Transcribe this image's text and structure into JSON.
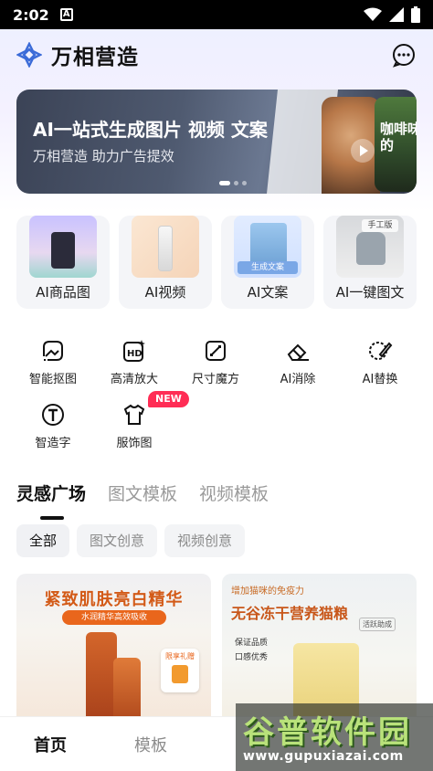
{
  "status_bar": {
    "time": "2:02",
    "notification_icon": "A"
  },
  "header": {
    "app_title": "万相营造"
  },
  "banner": {
    "title": "AI一站式生成图片 视频 文案",
    "subtitle": "万相营造 助力广告提效",
    "poster_text": "咖啡味的",
    "active_dot": 0
  },
  "feature_cards": [
    {
      "label": "AI商品图",
      "icon": "perfume-thumb"
    },
    {
      "label": "AI视频",
      "icon": "bottle-thumb"
    },
    {
      "label": "AI文案",
      "icon": "catfood-thumb",
      "tag": "生成文案"
    },
    {
      "label": "AI一键图文",
      "icon": "chair-thumb",
      "tag": "手工版"
    }
  ],
  "tools": [
    {
      "label": "智能抠图",
      "icon": "cutout-icon"
    },
    {
      "label": "高清放大",
      "icon": "hd-icon"
    },
    {
      "label": "尺寸魔方",
      "icon": "resize-icon"
    },
    {
      "label": "AI消除",
      "icon": "eraser-icon"
    },
    {
      "label": "AI替换",
      "icon": "replace-icon"
    },
    {
      "label": "智造字",
      "icon": "font-icon"
    },
    {
      "label": "服饰图",
      "icon": "shirt-icon",
      "badge": "NEW"
    }
  ],
  "section_tabs": [
    "灵感广场",
    "图文模板",
    "视频模板"
  ],
  "filter_chips": [
    "全部",
    "图文创意",
    "视频创意"
  ],
  "feed": {
    "card1": {
      "title": "紧致肌肤亮白精华",
      "subtitle": "水润精华高效吸收",
      "gift_label": "限享礼赠"
    },
    "card2": {
      "top_text": "增加猫咪的免疫力",
      "title": "无谷冻干营养猫粮",
      "tag": "活跃助成",
      "bullets": [
        "保证品质",
        "口感优秀"
      ]
    }
  },
  "bottom_nav": [
    "首页",
    "模板"
  ],
  "watermark": {
    "main": "谷普软件园",
    "url": "www.gupuxiazai.com"
  },
  "colors": {
    "accent": "#111111",
    "badge": "#ff2d55",
    "brand_orange": "#e9661c"
  }
}
